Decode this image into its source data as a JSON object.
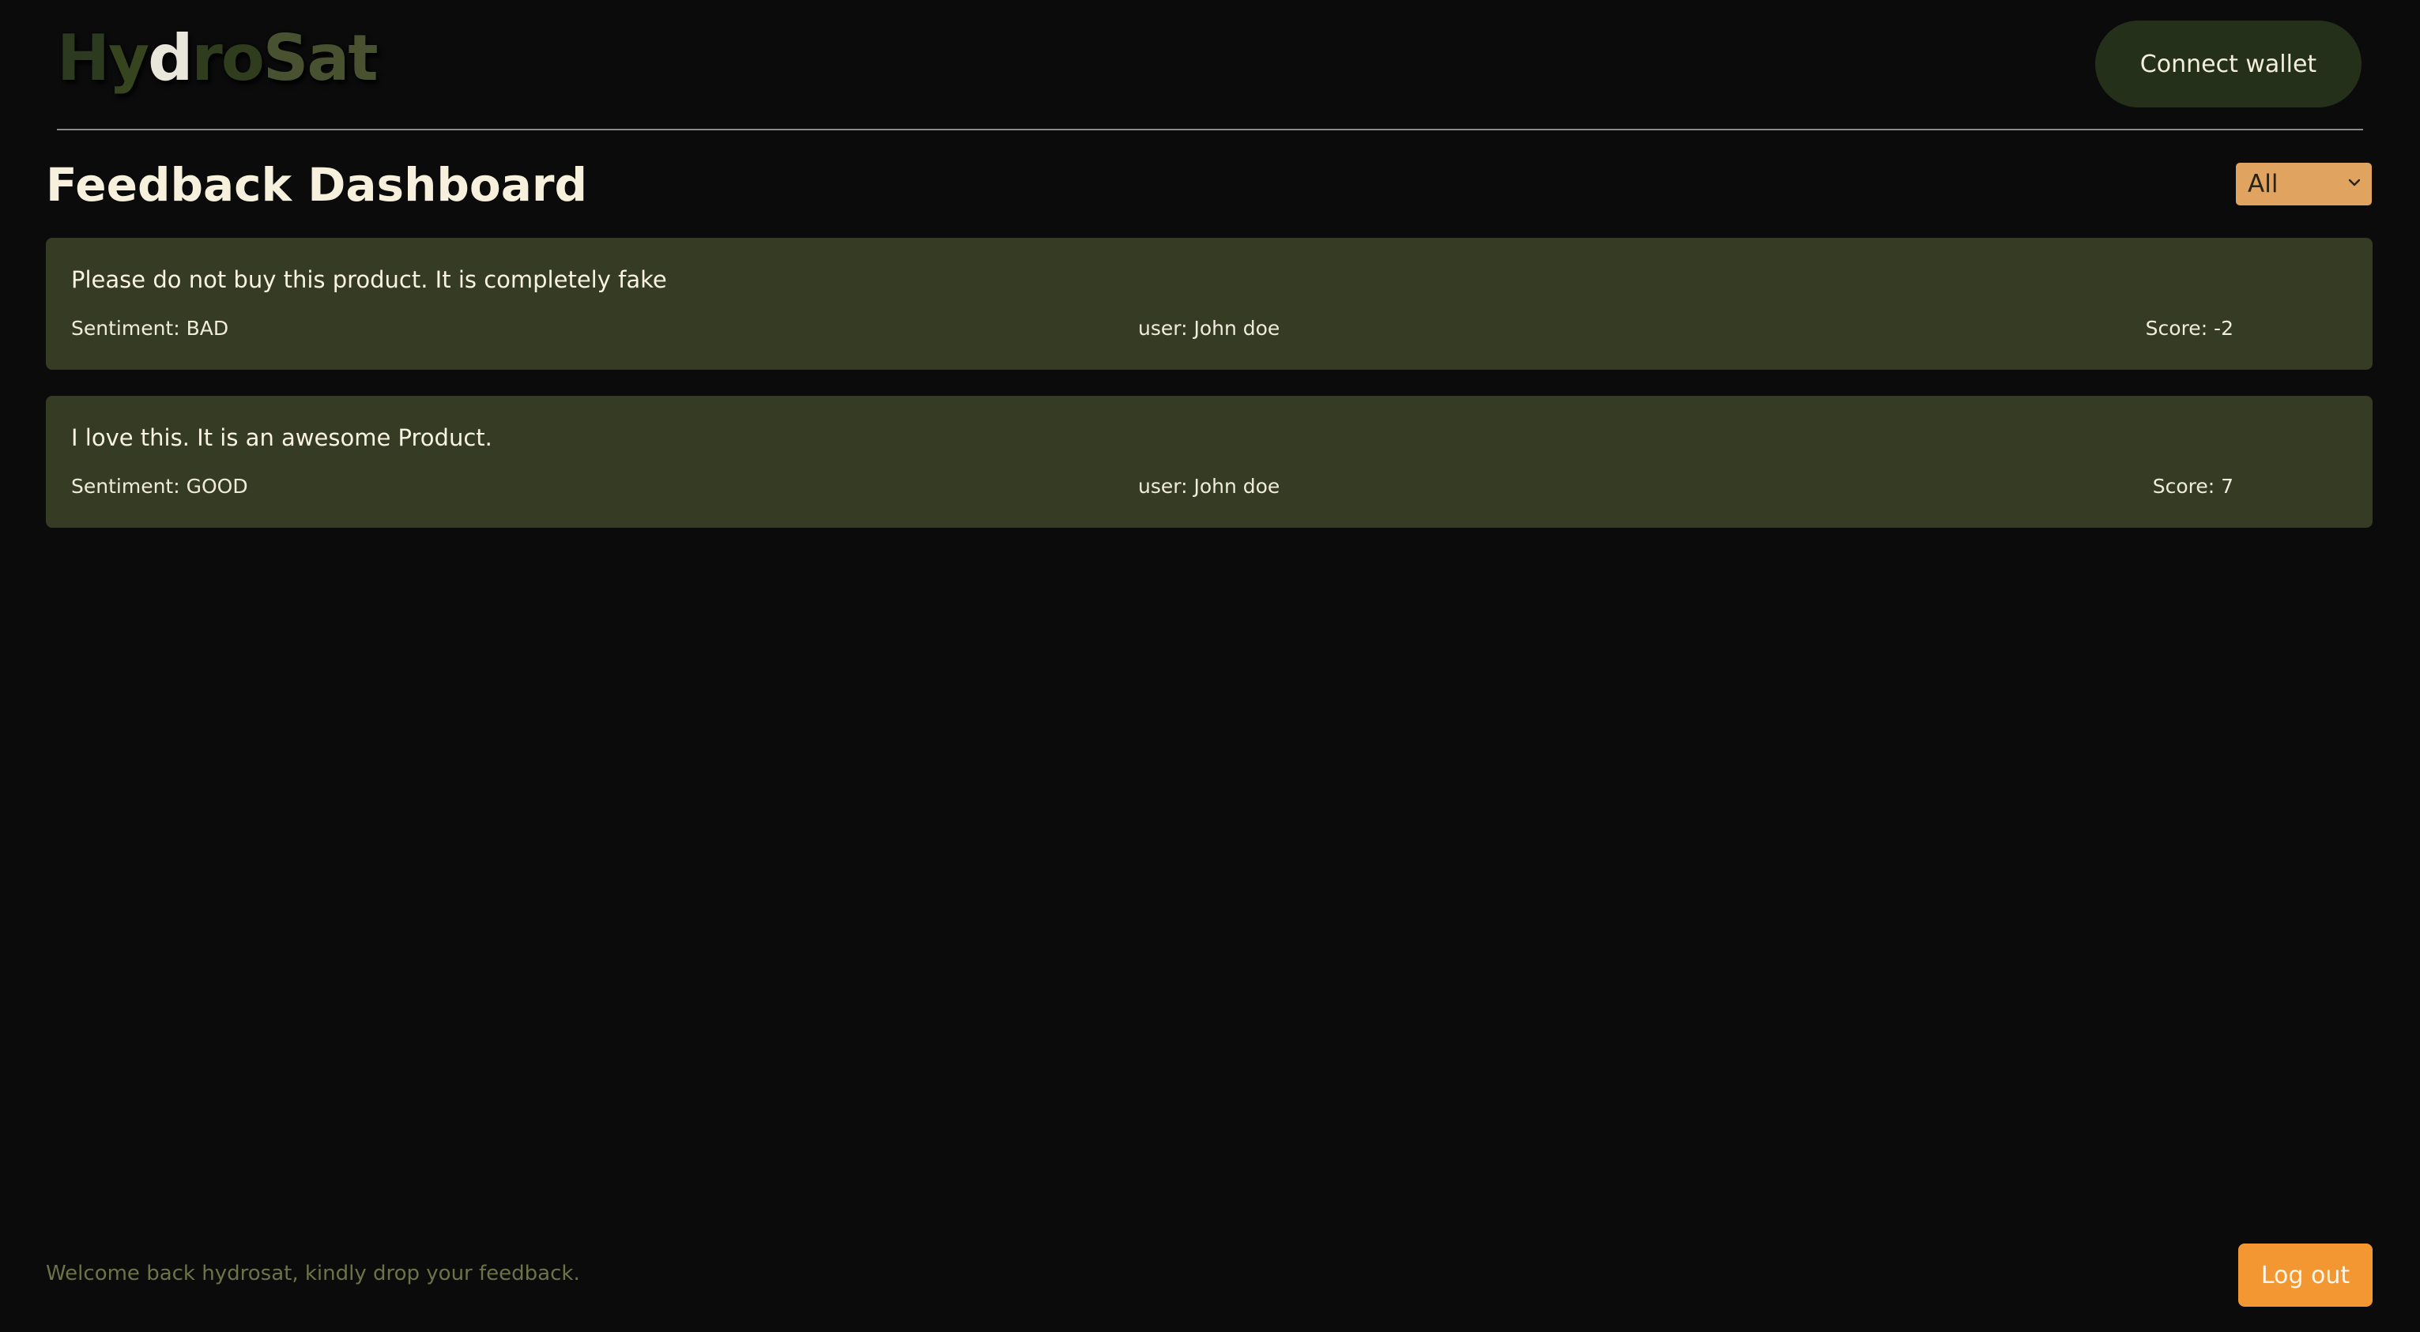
{
  "header": {
    "logo": {
      "letters": [
        {
          "char": "H",
          "color": "#2c3a1f"
        },
        {
          "char": "y",
          "color": "#37451f"
        },
        {
          "char": "d",
          "color": "#e9e6dc"
        },
        {
          "char": "r",
          "color": "#2f3d1e"
        },
        {
          "char": "o",
          "color": "#2f3d1e"
        },
        {
          "char": "S",
          "color": "#495230"
        },
        {
          "char": "a",
          "color": "#495230"
        },
        {
          "char": "t",
          "color": "#495230"
        }
      ]
    },
    "connect_wallet_label": "Connect wallet"
  },
  "dashboard": {
    "title": "Feedback Dashboard",
    "filter": {
      "selected": "All",
      "icon": "chevron-down-icon"
    }
  },
  "feedback": [
    {
      "message": "Please do not buy this product. It is completely fake",
      "sentiment": "Sentiment: BAD",
      "user": "user: John doe",
      "score": "Score: -2"
    },
    {
      "message": "I love this. It is an awesome Product.",
      "sentiment": "Sentiment: GOOD",
      "user": "user: John doe",
      "score": "Score: 7"
    }
  ],
  "footer": {
    "welcome": "Welcome back hydrosat, kindly drop your feedback.",
    "logout_label": "Log out"
  },
  "colors": {
    "background": "#0b0b0b",
    "card": "#363b23",
    "accent_orange": "#f39733",
    "filter_bg": "#e0a460",
    "connect_bg": "#243019"
  }
}
